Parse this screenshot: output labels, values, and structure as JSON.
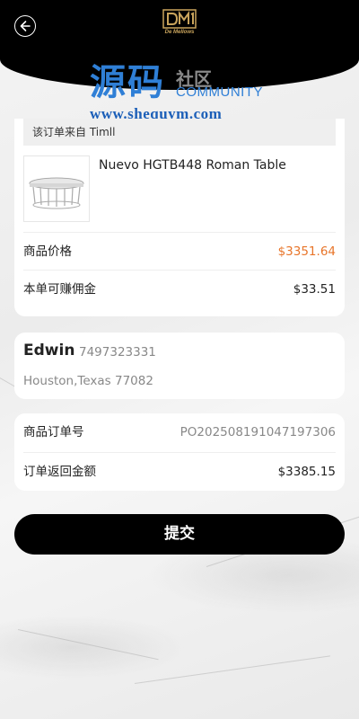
{
  "header": {
    "logo_text": "De Mellows",
    "back_icon": "back-arrow-icon"
  },
  "watermark": {
    "main": "源码",
    "sub_cn": "社区",
    "sub_en": "COMMUNITY",
    "url": "www.shequym.com"
  },
  "product_card": {
    "source_label": "该订单来自 Timll",
    "product_name": "Nuevo HGTB448 Roman Table",
    "price_label": "商品价格",
    "price_value": "$3351.64",
    "commission_label": "本单可赚佣金",
    "commission_value": "$33.51"
  },
  "address_card": {
    "name": "Edwin",
    "phone": "7497323331",
    "address": "Houston,Texas 77082"
  },
  "order_card": {
    "order_no_label": "商品订单号",
    "order_no_value": "PO202508191047197306",
    "return_amount_label": "订单返回金额",
    "return_amount_value": "$3385.15"
  },
  "submit_label": "提交",
  "colors": {
    "accent_price": "#e8752a",
    "header_bg": "#000000",
    "watermark_blue": "#2f7fd6",
    "logo_gold": "#c9a45c"
  }
}
